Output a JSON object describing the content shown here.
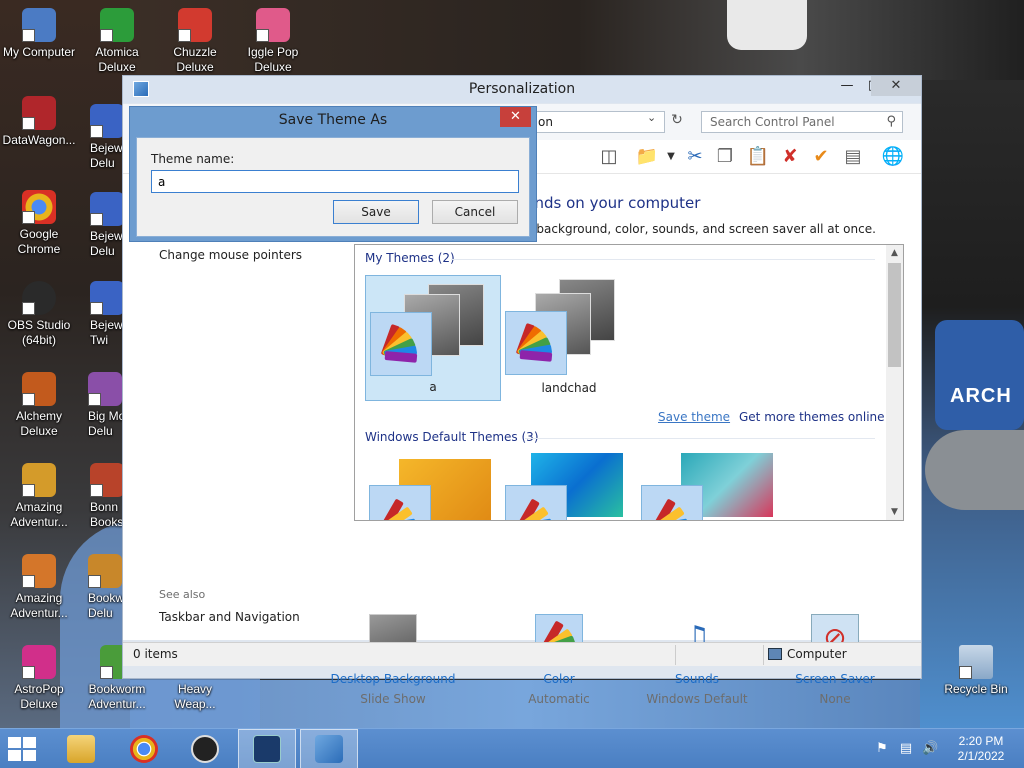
{
  "desktop": {
    "icons": [
      {
        "label": "My Computer",
        "color": "#4b7bc4"
      },
      {
        "label": "Atomica\nDeluxe",
        "color": "#2c9c3a"
      },
      {
        "label": "Chuzzle\nDeluxe",
        "color": "#d23a2f"
      },
      {
        "label": "Iggle Pop\nDeluxe",
        "color": "#e05a8a"
      },
      {
        "label": "DataWagon...",
        "color": "#b0262b"
      },
      {
        "label": "Bejew\nDelu",
        "color": "#3a63c4"
      },
      {
        "label": "Google\nChrome",
        "color": "#e8b41c"
      },
      {
        "label": "Bejew\nDelu",
        "color": "#3a63c4"
      },
      {
        "label": "OBS Studio\n(64bit)",
        "color": "#2a2a2a"
      },
      {
        "label": "Bejew\nTwi",
        "color": "#3a63c4"
      },
      {
        "label": "Alchemy\nDeluxe",
        "color": "#c25a1d"
      },
      {
        "label": "Big Mo\nDelu",
        "color": "#8a4fa8"
      },
      {
        "label": "Amazing\nAdventur...",
        "color": "#d49b2a"
      },
      {
        "label": "Bonn\nBooks",
        "color": "#b8432a"
      },
      {
        "label": "Amazing\nAdventur...",
        "color": "#d4762a"
      },
      {
        "label": "Bookw\nDelu",
        "color": "#c8872a"
      },
      {
        "label": "AstroPop\nDeluxe",
        "color": "#d12f8a"
      },
      {
        "label": "Bookworm\nAdventur...",
        "color": "#4a9c3a"
      },
      {
        "label": "Heavy\nWeap...",
        "color": "#5a5a5a"
      },
      {
        "label": "Recycle Bin",
        "color": "#8aa8c8"
      }
    ],
    "wallpaper_text": "ARCH"
  },
  "personalization": {
    "title": "Personalization",
    "address_fragment": "on",
    "search_placeholder": "Search Control Panel",
    "heading_fragment": "unds on your computer",
    "subhead_fragment": "p background, color, sounds, and screen saver all at once.",
    "sidebar": {
      "change_mouse_pointers": "Change mouse pointers",
      "see_also": "See also",
      "taskbar_navigation": "Taskbar and Navigation"
    },
    "my_themes": {
      "header": "My Themes (2)",
      "items": [
        {
          "label": "a",
          "selected": true
        },
        {
          "label": "landchad",
          "selected": false
        }
      ],
      "save_theme": "Save theme",
      "get_more": "Get more themes online"
    },
    "default_themes": {
      "header": "Windows Default Themes (3)"
    },
    "settings": [
      {
        "label": "Desktop Background",
        "value": "Slide Show",
        "icon": "desktop-background-icon"
      },
      {
        "label": "Color",
        "value": "Automatic",
        "icon": "color-icon"
      },
      {
        "label": "Sounds",
        "value": "Windows Default",
        "icon": "sounds-icon"
      },
      {
        "label": "Screen Saver",
        "value": "None",
        "icon": "screen-saver-icon"
      }
    ],
    "status": {
      "items": "0 items",
      "zone": "Computer"
    }
  },
  "dialog": {
    "title": "Save Theme As",
    "field_label": "Theme name:",
    "field_value": "a",
    "save_label": "Save",
    "cancel_label": "Cancel"
  },
  "taskbar": {
    "time": "2:20 PM",
    "date": "2/1/2022"
  },
  "colors": {
    "accent": "#1e6ec8",
    "link": "#1e3287",
    "selection": "#cce6f7",
    "close_red": "#c7403b",
    "taskbar": "#4a7fc2"
  }
}
